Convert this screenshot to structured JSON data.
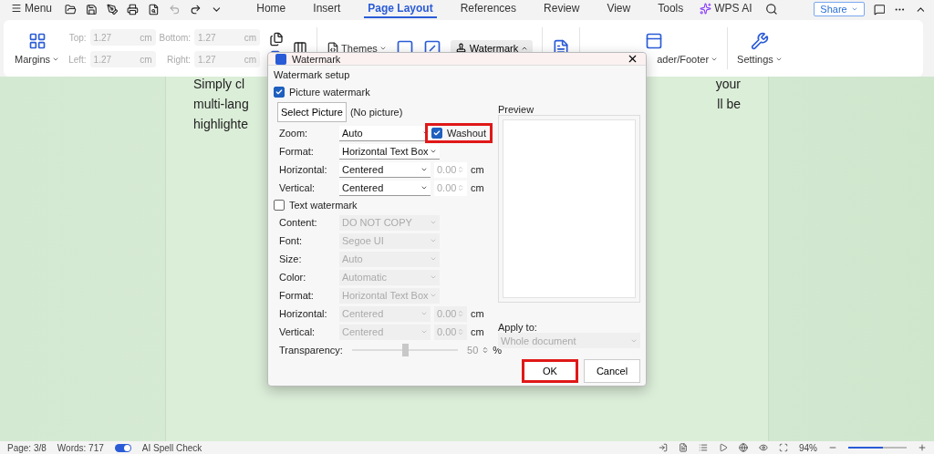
{
  "menu_bar": {
    "menu": "Menu",
    "tabs": [
      {
        "label": "Home",
        "selected": false
      },
      {
        "label": "Insert",
        "selected": false
      },
      {
        "label": "Page Layout",
        "selected": true
      },
      {
        "label": "References",
        "selected": false
      },
      {
        "label": "Review",
        "selected": false
      },
      {
        "label": "View",
        "selected": false
      },
      {
        "label": "Tools",
        "selected": false
      }
    ],
    "ai": "WPS AI",
    "share": "Share"
  },
  "ribbon": {
    "margins": "Margins",
    "fields": [
      {
        "label": "Top:",
        "value": "1.27",
        "unit": "cm",
        "disabled": true
      },
      {
        "label": "Bottom:",
        "value": "1.27",
        "unit": "cm",
        "disabled": true
      },
      {
        "label": "Left:",
        "value": "1.27",
        "unit": "cm",
        "disabled": true
      },
      {
        "label": "Right:",
        "value": "1.27",
        "unit": "cm",
        "disabled": true
      }
    ],
    "themes": "Themes",
    "watermark": "Watermark",
    "header_footer": "ader/Footer",
    "settings": "Settings"
  },
  "document": {
    "lines": [
      {
        "left": "Simply cl",
        "right": "your"
      },
      {
        "left": "multi-lang",
        "right": "ll be"
      },
      {
        "left": "highlighte"
      }
    ]
  },
  "dialog": {
    "title": "Watermark",
    "group": "Watermark setup",
    "picture": {
      "label": "Picture watermark",
      "checked": true,
      "select": "Select Picture",
      "file": "(No picture)",
      "washout": {
        "label": "Washout",
        "checked": true,
        "highlighted": true
      },
      "rows": [
        {
          "label": "Zoom:",
          "value": "Auto"
        },
        {
          "label": "Format:",
          "value": "Horizontal Text Box"
        },
        {
          "label": "Horizontal:",
          "value": "Centered",
          "number": "0.00",
          "unit": "cm"
        },
        {
          "label": "Vertical:",
          "value": "Centered",
          "number": "0.00",
          "unit": "cm"
        }
      ]
    },
    "text": {
      "label": "Text watermark",
      "checked": false,
      "disabled": true,
      "rows": [
        {
          "label": "Content:",
          "value": "DO NOT COPY"
        },
        {
          "label": "Font:",
          "value": "Segoe UI"
        },
        {
          "label": "Size:",
          "value": "Auto"
        },
        {
          "label": "Color:",
          "value": "Automatic"
        },
        {
          "label": "Format:",
          "value": "Horizontal Text Box"
        },
        {
          "label": "Horizontal:",
          "value": "Centered",
          "number": "0.00",
          "unit": "cm"
        },
        {
          "label": "Vertical:",
          "value": "Centered",
          "number": "0.00",
          "unit": "cm"
        }
      ],
      "transparency": {
        "label": "Transparency:",
        "level": 0.5,
        "value": "50",
        "unit": "%"
      }
    },
    "preview": "Preview",
    "apply_label": "Apply to:",
    "apply_value": "Whole document",
    "buttons": [
      {
        "label": "OK",
        "highlighted": true
      },
      {
        "label": "Cancel",
        "highlighted": false
      }
    ]
  },
  "status_bar": {
    "page": "Page: 3/8",
    "words": "Words: 717",
    "spell": {
      "label": "AI Spell Check",
      "on": true
    },
    "zoom": "94%",
    "zoom_level": {
      "level": 0.6
    }
  }
}
